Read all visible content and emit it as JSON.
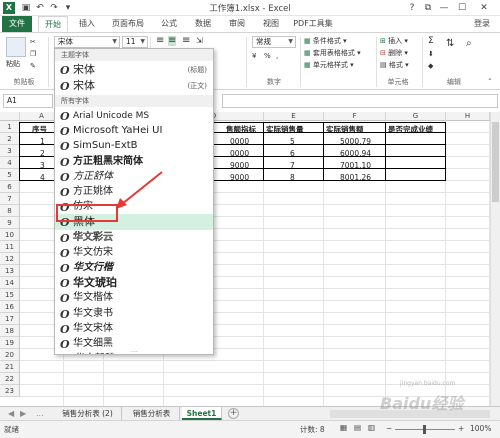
{
  "window": {
    "title": "工作簿1.xlsx - Excel",
    "help": "?",
    "restore": "⧉",
    "minimize": "—",
    "maximize": "☐",
    "close": "✕"
  },
  "quick_access": {
    "save_icon": "save-icon",
    "undo_icon": "undo-icon",
    "redo_icon": "redo-icon"
  },
  "tabs": [
    "文件",
    "开始",
    "插入",
    "页面布局",
    "公式",
    "数据",
    "审阅",
    "视图",
    "PDF工具集"
  ],
  "login": "登录",
  "ribbon": {
    "paste": "粘贴",
    "clipboard": "剪贴板",
    "font_name": "宋体",
    "font_size": "11",
    "number_format": "常规",
    "number_group": "数字",
    "conditional_format": "条件格式",
    "table_format": "套用表格格式",
    "cell_styles": "单元格样式",
    "insert": "插入",
    "delete": "删除",
    "format": "格式",
    "cells_group": "单元格",
    "sum": "Σ",
    "edit_group": "编辑",
    "percent": "%",
    "comma": ","
  },
  "formula_bar": {
    "name_box": "A1"
  },
  "font_dropdown": {
    "theme_section": "主题字体",
    "theme_fonts": [
      {
        "name": "宋体",
        "tag": "(标题)"
      },
      {
        "name": "宋体",
        "tag": "(正文)"
      }
    ],
    "all_section": "所有字体",
    "fonts": [
      "Arial Unicode MS",
      "Microsoft YaHei UI",
      "SimSun-ExtB",
      "方正粗黑宋简体",
      "方正舒体",
      "方正姚体",
      "仿宋",
      "黑体",
      "华文彩云",
      "华文仿宋",
      "华文行楷",
      "华文琥珀",
      "华文楷体",
      "华文隶书",
      "华文宋体",
      "华文细黑",
      "华文新魏"
    ],
    "highlighted": "黑体",
    "grip": "...."
  },
  "grid": {
    "col_letters": [
      "A",
      "B",
      "C",
      "D",
      "E",
      "F",
      "G",
      "H",
      "I"
    ],
    "rows": [
      "1",
      "2",
      "3",
      "4",
      "5",
      "6",
      "7",
      "8",
      "9",
      "10",
      "11",
      "12",
      "13",
      "14",
      "15",
      "16",
      "17",
      "18",
      "19",
      "20",
      "21",
      "22",
      "23"
    ],
    "header_a": "序号",
    "header_d": "售额指标",
    "header_e": "实际销售量",
    "header_f": "实际销售额",
    "header_g": "是否完成业绩",
    "seq": [
      "1",
      "2",
      "3",
      "4"
    ],
    "d_values": [
      "0000",
      "0000",
      "9000",
      "9000"
    ],
    "e_values": [
      "5",
      "6",
      "7",
      "8"
    ],
    "f_values": [
      "5000.79",
      "6000.94",
      "7001.10",
      "8001.26"
    ]
  },
  "sheets": [
    "销售分析表 (2)",
    "销售分析表",
    "Sheet1"
  ],
  "sheet_nav": {
    "prev": "◀",
    "next": "▶",
    "more": "...",
    "add": "+"
  },
  "status": {
    "ready": "就绪",
    "count": "计数: 8",
    "zoom": "100%",
    "zoom_minus": "−",
    "zoom_plus": "+"
  },
  "watermark": "Baidu经验",
  "watermark_url": "jingyan.baidu.com",
  "colors": {
    "accent": "#217346",
    "highlight": "#d3f0e0",
    "annotation": "#e53935"
  }
}
